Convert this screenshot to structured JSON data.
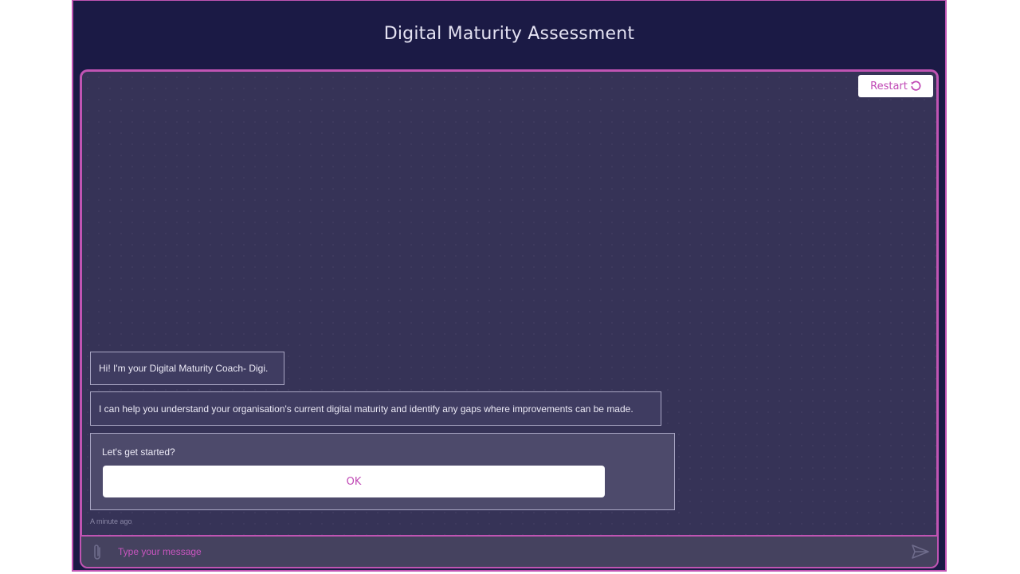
{
  "header": {
    "title": "Digital Maturity Assessment"
  },
  "toolbar": {
    "restart_label": "Restart",
    "restart_icon": "restart-icon"
  },
  "chat": {
    "messages": [
      {
        "text": "Hi! I'm your Digital Maturity Coach- Digi."
      },
      {
        "text": "I can help you understand your organisation's current digital maturity and identify any gaps where improvements can be made."
      }
    ],
    "card": {
      "text": "Let's get started?",
      "button_label": "OK"
    },
    "timestamp": "A minute ago"
  },
  "composer": {
    "placeholder": "Type your message",
    "attach_icon": "paperclip-icon",
    "send_icon": "send-icon"
  },
  "colors": {
    "header_bg": "#1b1a45",
    "panel_bg": "#363357",
    "accent": "#c054b3",
    "button_text": "#c048b5"
  }
}
